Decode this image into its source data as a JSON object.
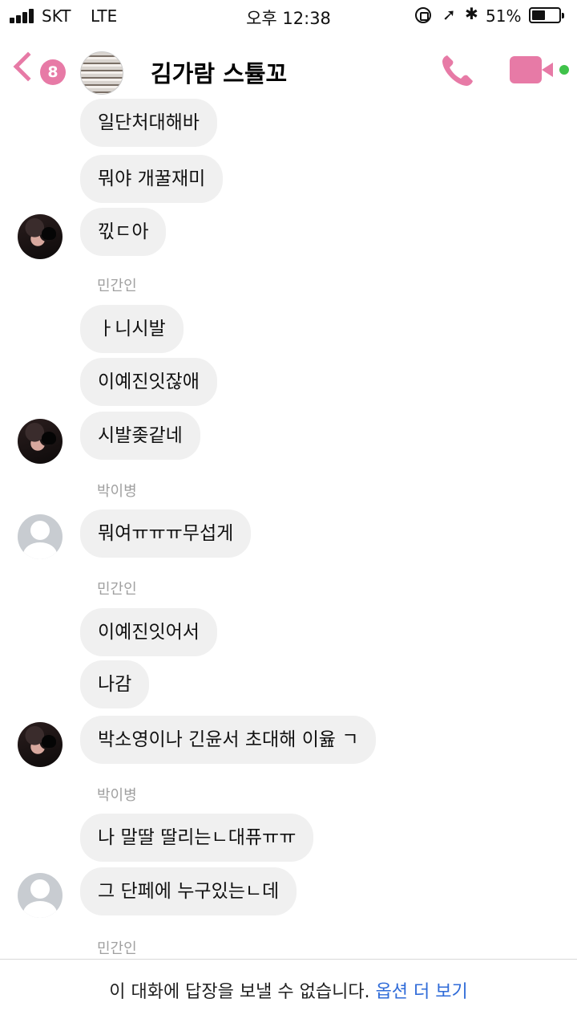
{
  "status_bar": {
    "carrier": "SKT",
    "network": "LTE",
    "time": "오후 12:38",
    "battery_percent": "51%",
    "battery_level": 0.51
  },
  "header": {
    "back_icon": "chevron-left-icon",
    "unread_count": "8",
    "title": "김가람 스튤꼬",
    "accent_color": "#e77aa6",
    "call_icon": "phone-icon",
    "video_icon": "video-camera-icon",
    "active_color": "#3fc24a"
  },
  "messages": {
    "m0": "일단처대해바",
    "m1": "뭐야 개꿀재미",
    "m2": "끿ㄷ아",
    "s1": "민간인",
    "m3": "ㅏ니시발",
    "m4": "이예진잇잖애",
    "m5": "시발좆같네",
    "s2": "박이병",
    "m6": "뭐여ㅠㅠㅠ무섭게",
    "s3": "민간인",
    "m7": "이예진잇어서",
    "m8": "나감",
    "m9": "박소영이나 긴윤서 초대해 이윮 ㄱ",
    "s4": "박이병",
    "m10": "나 말딸 딸리는ㄴ대퓨ㅠㅠ",
    "m11": "그 단페에 누구있는ㄴ데",
    "s5": "민간인"
  },
  "footer": {
    "notice": "이 대화에 답장을 보낼 수 없습니다.",
    "link": "옵션 더 보기"
  }
}
